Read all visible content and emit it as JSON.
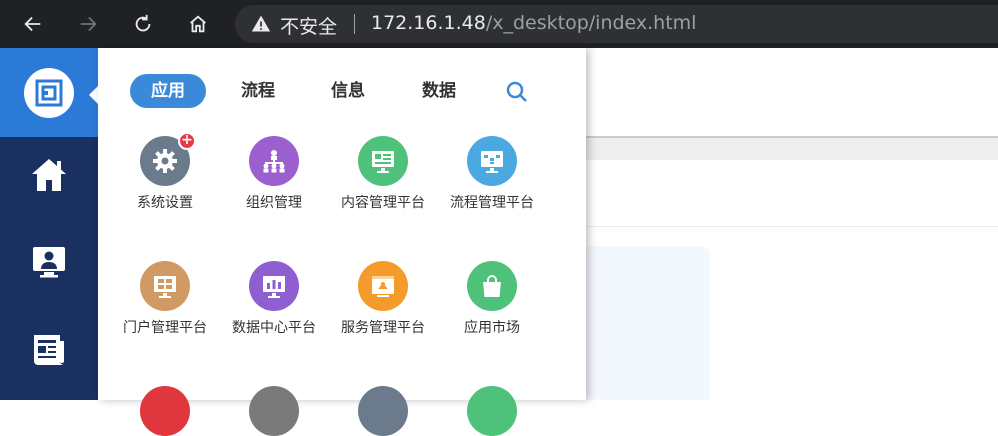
{
  "browser": {
    "security_label": "不安全",
    "url_host": "172.16.1.48",
    "url_path": "/x_desktop/index.html"
  },
  "sidebar": {
    "items": [
      {
        "icon": "home-icon"
      },
      {
        "icon": "monitor-user-icon"
      },
      {
        "icon": "newspaper-icon"
      }
    ]
  },
  "panel": {
    "tabs": [
      {
        "label": "应用",
        "active": true
      },
      {
        "label": "流程",
        "active": false
      },
      {
        "label": "信息",
        "active": false
      },
      {
        "label": "数据",
        "active": false
      }
    ],
    "apps": [
      {
        "label": "系统设置",
        "icon": "gear-icon",
        "color": "#6b7b8c",
        "badge": true
      },
      {
        "label": "组织管理",
        "icon": "org-chart-icon",
        "color": "#9b5fd0"
      },
      {
        "label": "内容管理平台",
        "icon": "content-board-icon",
        "color": "#4ec27a"
      },
      {
        "label": "流程管理平台",
        "icon": "process-board-icon",
        "color": "#4aa9e0"
      },
      {
        "label": "门户管理平台",
        "icon": "portal-grid-icon",
        "color": "#d19a64"
      },
      {
        "label": "数据中心平台",
        "icon": "data-chart-icon",
        "color": "#8e5fd0"
      },
      {
        "label": "服务管理平台",
        "icon": "service-board-icon",
        "color": "#f39c2b"
      },
      {
        "label": "应用市场",
        "icon": "shopping-bag-icon",
        "color": "#4ec27a"
      }
    ],
    "partial_row_colors": [
      "#e0363e",
      "#7a7a7a",
      "#6b7b8c",
      "#4ec27a"
    ]
  }
}
